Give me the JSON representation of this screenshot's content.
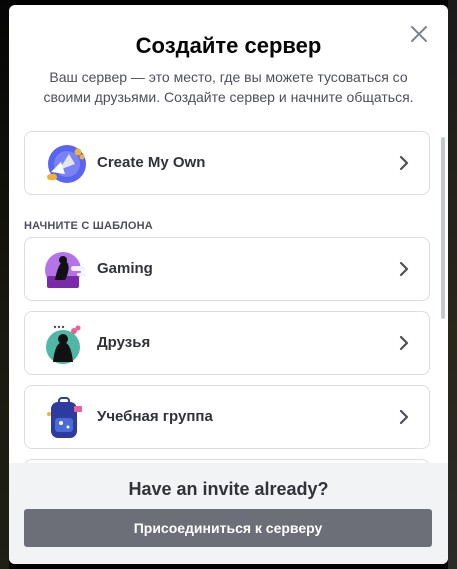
{
  "modal": {
    "title": "Создайте сервер",
    "subtitle": "Ваш сервер — это место, где вы можете тусоваться со своими друзьями. Создайте сервер и начните общаться.",
    "close_icon": "close-icon"
  },
  "options": {
    "create": {
      "label": "Create My Own",
      "icon": "create-server-icon"
    },
    "section_header": "НАЧНИТЕ С ШАБЛОНА",
    "templates": [
      {
        "label": "Gaming",
        "icon": "gaming-template-icon"
      },
      {
        "label": "Друзья",
        "icon": "friends-template-icon"
      },
      {
        "label": "Учебная группа",
        "icon": "study-group-template-icon"
      }
    ]
  },
  "footer": {
    "title": "Have an invite already?",
    "join_button": "Присоединиться к серверу"
  },
  "colors": {
    "modal_bg": "#ffffff",
    "footer_bg": "#f2f3f5",
    "button_bg": "#6d6f78",
    "text_primary": "#060607",
    "text_secondary": "#4e5058",
    "option_border": "#dcdde0"
  }
}
